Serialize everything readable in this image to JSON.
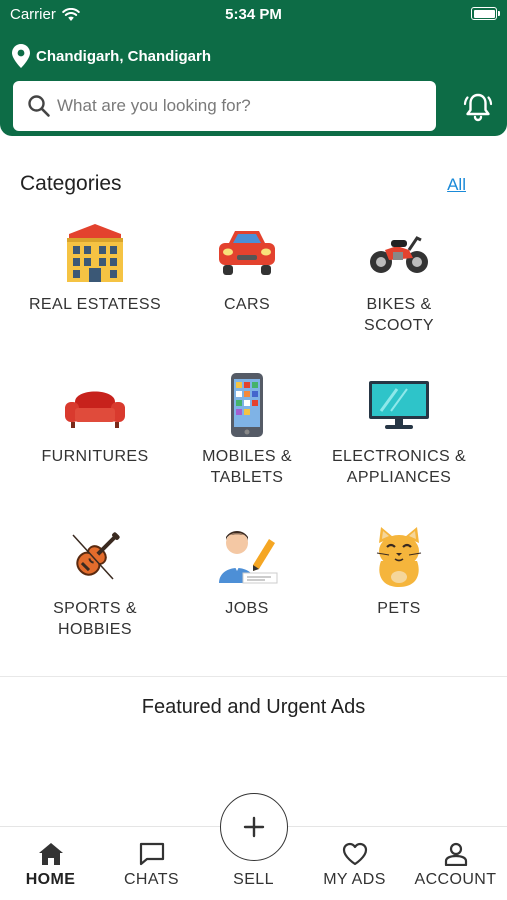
{
  "status_bar": {
    "carrier": "Carrier",
    "time": "5:34 PM"
  },
  "location": {
    "text": "Chandigarh, Chandigarh"
  },
  "search": {
    "placeholder": "What are you looking for?",
    "value": ""
  },
  "categories": {
    "title": "Categories",
    "all_link": "All",
    "items": [
      {
        "label": "REAL ESTATESS",
        "icon": "building-icon"
      },
      {
        "label": "CARS",
        "icon": "car-icon"
      },
      {
        "label": "BIKES &\nSCOOTY",
        "icon": "motorbike-icon"
      },
      {
        "label": "FURNITURES",
        "icon": "sofa-icon"
      },
      {
        "label": "MOBILES &\nTABLETS",
        "icon": "smartphone-icon"
      },
      {
        "label": "ELECTRONICS &\nAPPLIANCES",
        "icon": "tv-icon"
      },
      {
        "label": "SPORTS &\nHOBBIES",
        "icon": "violin-icon"
      },
      {
        "label": "JOBS",
        "icon": "worker-icon"
      },
      {
        "label": "PETS",
        "icon": "cat-icon"
      }
    ]
  },
  "featured": {
    "title": "Featured and Urgent Ads"
  },
  "tabbar": {
    "home": "HOME",
    "chats": "CHATS",
    "sell": "SELL",
    "my_ads": "MY ADS",
    "account": "ACCOUNT",
    "active": "HOME"
  },
  "colors": {
    "header": "#0d6c46",
    "link": "#1a8ad8"
  }
}
